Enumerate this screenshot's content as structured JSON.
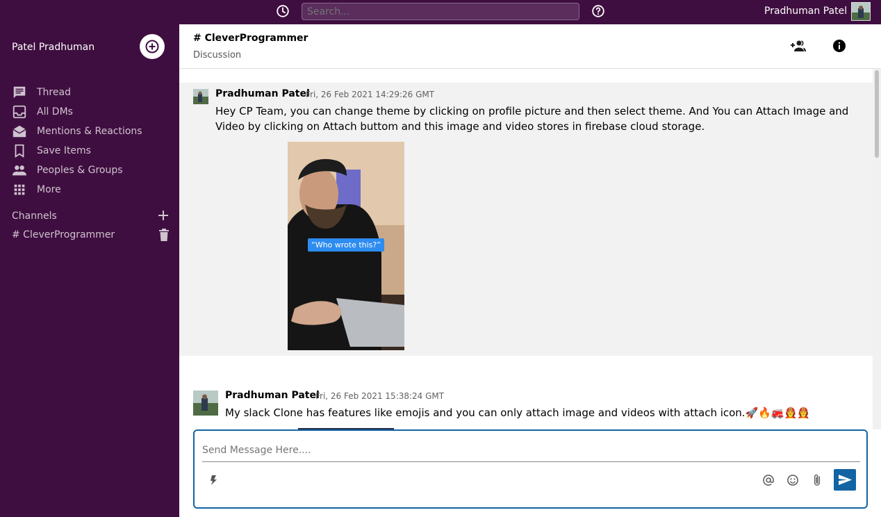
{
  "topbar": {
    "search_placeholder": "Search...",
    "user_name": "Pradhuman Patel"
  },
  "sidebar": {
    "workspace_name": "Patel Pradhuman",
    "items": [
      {
        "label": "Thread",
        "icon": "thread-icon"
      },
      {
        "label": "All DMs",
        "icon": "inbox-icon"
      },
      {
        "label": "Mentions & Reactions",
        "icon": "drafts-icon"
      },
      {
        "label": "Save Items",
        "icon": "bookmark-icon"
      },
      {
        "label": "Peoples & Groups",
        "icon": "people-icon"
      },
      {
        "label": "More",
        "icon": "apps-icon"
      }
    ],
    "channels_label": "Channels",
    "channels": [
      {
        "label": "# CleverProgrammer"
      }
    ]
  },
  "chat": {
    "channel_title": "# CleverProgrammer",
    "channel_description": "Discussion",
    "messages": [
      {
        "author": "Pradhuman Patel",
        "timestamp": "Fri, 26 Feb 2021 14:29:26 GMT",
        "text": "Hey CP Team, you can change theme by clicking on profile picture and then select theme. And You can Attach Image and Video by clicking on Attach buttom and this image and video stores in firebase cloud storage.",
        "image_caption": "“Who wrote this?”"
      },
      {
        "author": "Pradhuman Patel",
        "timestamp": "Fri, 26 Feb 2021 15:38:24 GMT",
        "text": "My slack Clone has features like emojis and you can only attach image and videos with attach icon.🚀🔥🚒👩‍🚒👩‍🚒"
      }
    ]
  },
  "composer": {
    "placeholder": "Send Message Here...."
  },
  "colors": {
    "sidebar": "#3f0e40",
    "accent": "#1264a3"
  }
}
